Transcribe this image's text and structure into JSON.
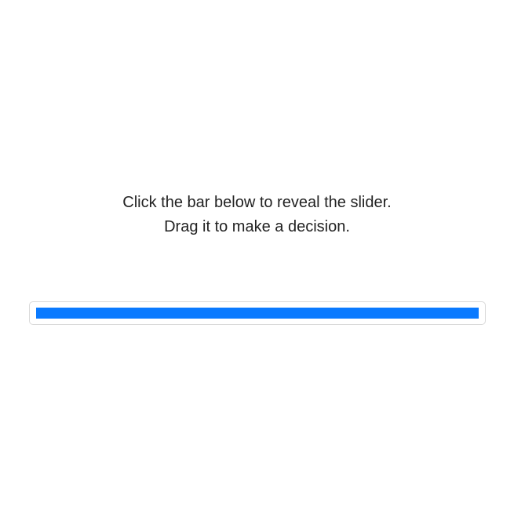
{
  "instructions": {
    "line1": "Click the bar below to reveal the slider.",
    "line2": "Drag it to make a decision."
  },
  "slider": {
    "fill_color": "#0a7aff",
    "value": 100
  }
}
